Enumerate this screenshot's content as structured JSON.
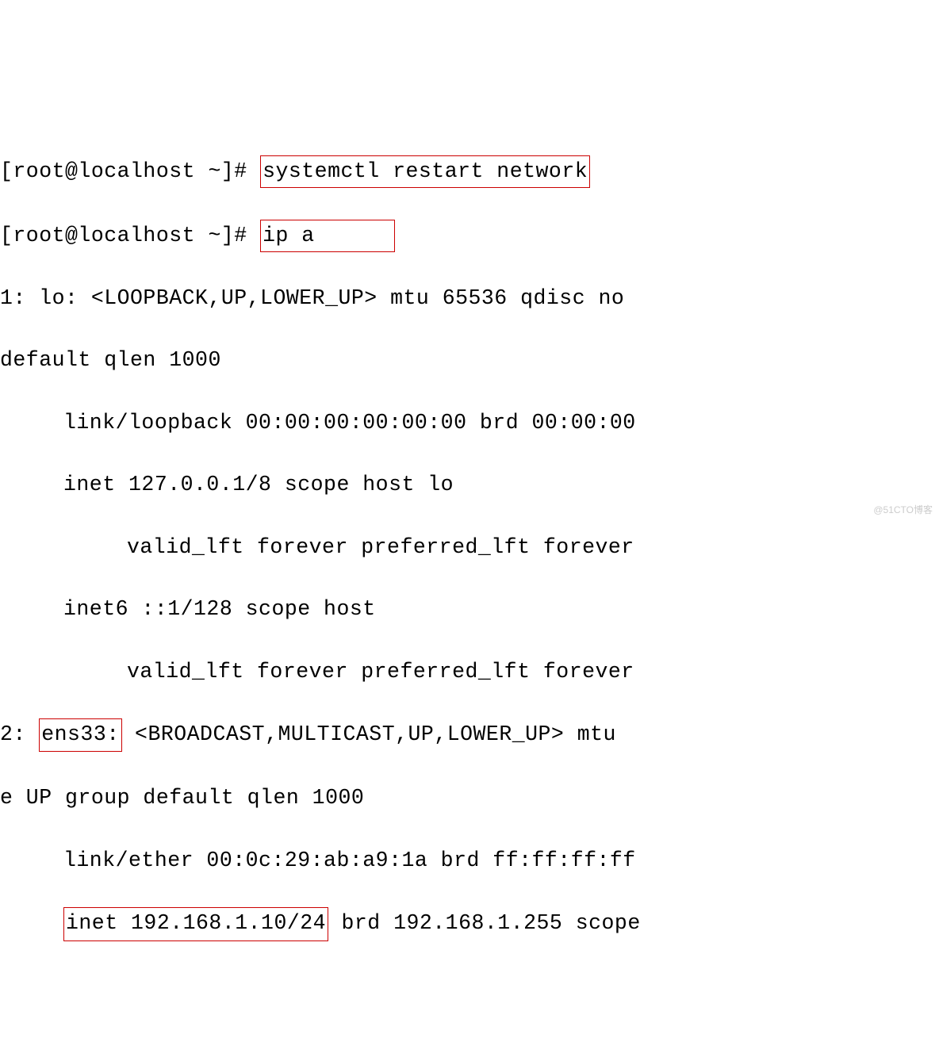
{
  "prompt1": "[root@localhost ~]#",
  "cmd1": "systemctl restart network",
  "prompt2": "[root@localhost ~]#",
  "cmd2": "ip a",
  "lo_header": "1: lo: <LOOPBACK,UP,LOWER_UP> mtu 65536 qdisc no",
  "lo_header2": "default qlen 1000",
  "lo_link": "link/loopback 00:00:00:00:00:00 brd 00:00:00",
  "lo_inet": "inet 127.0.0.1/8 scope host lo",
  "lo_valid1": "valid_lft forever preferred_lft forever",
  "lo_inet6": "inet6 ::1/128 scope host",
  "lo_valid2": "valid_lft forever preferred_lft forever",
  "ens_prefix": "2: ",
  "ens_name": "ens33:",
  "ens_rest": " <BROADCAST,MULTICAST,UP,LOWER_UP> mtu ",
  "ens_header2": "e UP group default qlen 1000",
  "ens_link": "link/ether 00:0c:29:ab:a9:1a brd ff:ff:ff:ff",
  "ens_inet_box": "inet 192.168.1.10/24",
  "ens_inet_rest": " brd 192.168.1.255 scope",
  "watermark": "@51CTO博客"
}
